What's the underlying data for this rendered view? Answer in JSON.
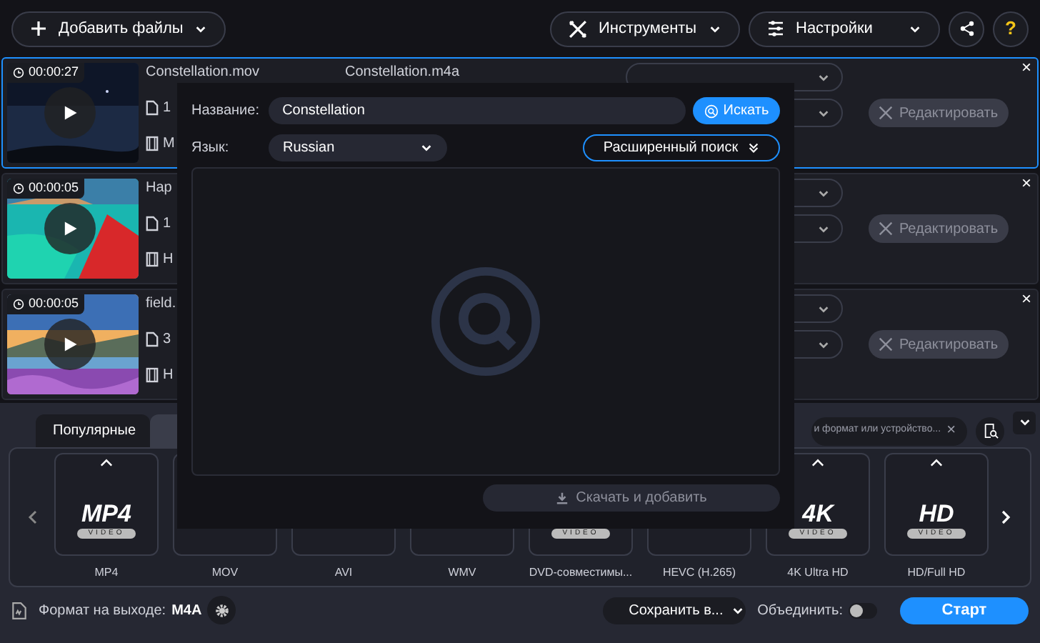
{
  "toolbar": {
    "add_files": "Добавить файлы",
    "tools": "Инструменты",
    "settings": "Настройки",
    "help": "?"
  },
  "files": [
    {
      "duration": "00:00:27",
      "name": "Constellation.mov",
      "output_name": "Constellation.m4a",
      "line_1": "1",
      "line_2": "M",
      "selected": true,
      "edit": "Редактировать",
      "close": "×"
    },
    {
      "duration": "00:00:05",
      "name": "Hap",
      "line_1": "1",
      "line_2": "H",
      "selected": false,
      "edit": "Редактировать",
      "close": "×"
    },
    {
      "duration": "00:00:05",
      "name": "field.",
      "line_1": "3",
      "line_2": "H",
      "selected": false,
      "edit": "Редактировать",
      "close": "×"
    }
  ],
  "format_tabs": [
    {
      "label": "Популярные",
      "selected": true
    },
    {
      "selected": false
    }
  ],
  "format_search": {
    "value": "и формат или устройство...",
    "clear": "×"
  },
  "formats": [
    {
      "label": "MP4",
      "logo": "MP4",
      "sub": "VIDEO",
      "caret": true
    },
    {
      "label": "MOV"
    },
    {
      "label": "AVI"
    },
    {
      "label": "WMV"
    },
    {
      "label": "DVD-совместимы...",
      "sub": "VIDEO"
    },
    {
      "label": "HEVC (H.265)"
    },
    {
      "label": "4K Ultra HD",
      "logo": "4K",
      "sub": "VIDEO",
      "caret": true
    },
    {
      "label": "HD/Full HD",
      "logo": "HD",
      "sub": "VIDEO",
      "caret": true
    }
  ],
  "footer": {
    "format_label": "Формат на выходе:",
    "format_value": "M4A",
    "save": "Сохранить в...",
    "merge_label": "Объединить:",
    "merge_on": false,
    "start": "Старт"
  },
  "dialog": {
    "name_label": "Название:",
    "name_value": "Constellation",
    "search": "Искать",
    "lang_label": "Язык:",
    "lang_value": "Russian",
    "advanced": "Расширенный поиск",
    "download": "Скачать и добавить",
    "download_disabled": true
  }
}
